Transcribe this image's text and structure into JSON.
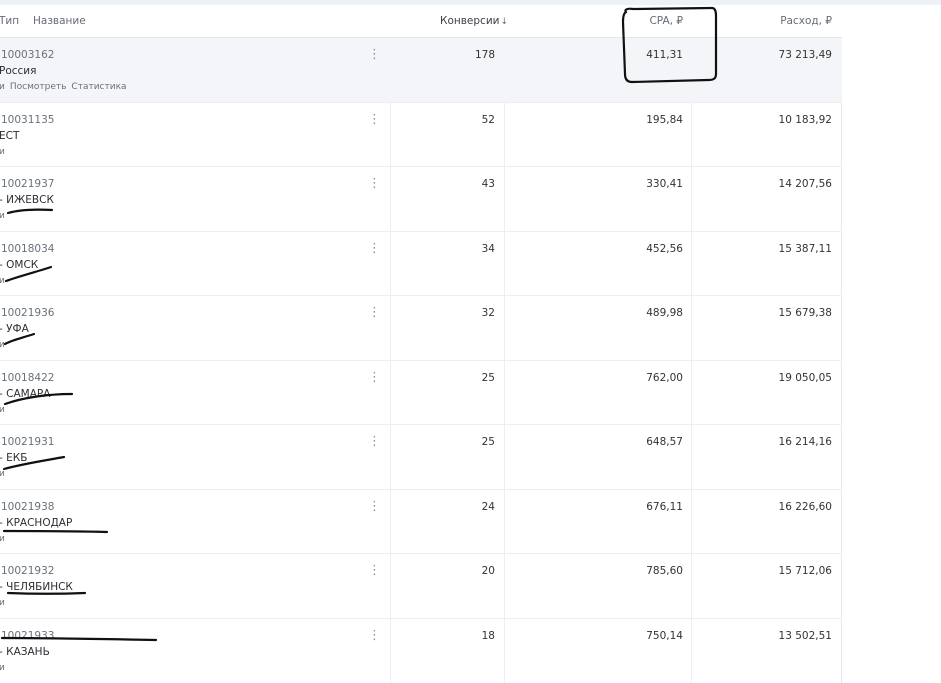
{
  "header": {
    "type_label": "Тип",
    "name_label": "Название",
    "conversions_label": "Конверсии",
    "sort_icon": "↓",
    "cpa_label": "CPA, ₽",
    "cost_label": "Расход, ₽"
  },
  "menu_icon": "⋮",
  "rows": [
    {
      "id": "10003162",
      "name": "Россия",
      "links": [
        "и",
        "Посмотреть",
        "Статистика"
      ],
      "conversions": "178",
      "cpa": "411,31",
      "cost": "73 213,49"
    },
    {
      "id": "10031135",
      "name": "ЕСТ",
      "links": [
        "и"
      ],
      "conversions": "52",
      "cpa": "195,84",
      "cost": "10 183,92"
    },
    {
      "id": "10021937",
      "name": "- ИЖЕВСК",
      "links": [
        "и"
      ],
      "conversions": "43",
      "cpa": "330,41",
      "cost": "14 207,56"
    },
    {
      "id": "10018034",
      "name": "- ОМСК",
      "links": [
        "и"
      ],
      "conversions": "34",
      "cpa": "452,56",
      "cost": "15 387,11"
    },
    {
      "id": "10021936",
      "name": "- УФА",
      "links": [
        "и"
      ],
      "conversions": "32",
      "cpa": "489,98",
      "cost": "15 679,38"
    },
    {
      "id": "10018422",
      "name": "- САМАРА",
      "links": [
        "и"
      ],
      "conversions": "25",
      "cpa": "762,00",
      "cost": "19 050,05"
    },
    {
      "id": "10021931",
      "name": "- ЕКБ",
      "links": [
        "и"
      ],
      "conversions": "25",
      "cpa": "648,57",
      "cost": "16 214,16"
    },
    {
      "id": "10021938",
      "name": "- КРАСНОДАР",
      "links": [
        "и"
      ],
      "conversions": "24",
      "cpa": "676,11",
      "cost": "16 226,60"
    },
    {
      "id": "10021932",
      "name": "- ЧЕЛЯБИНСК",
      "links": [
        "и"
      ],
      "conversions": "20",
      "cpa": "785,60",
      "cost": "15 712,06"
    },
    {
      "id": "10021933",
      "name": "- КАЗАНЬ",
      "links": [
        "и"
      ],
      "conversions": "18",
      "cpa": "750,14",
      "cost": "13 502,51"
    }
  ]
}
